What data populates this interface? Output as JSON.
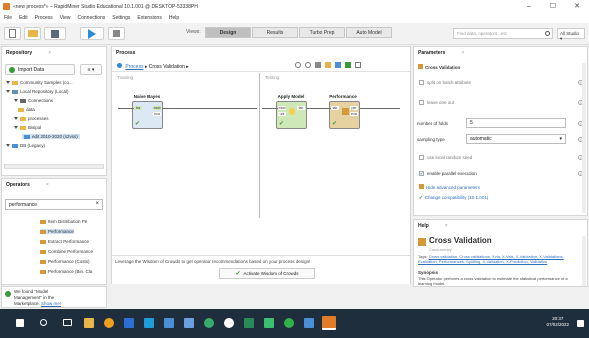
{
  "window": {
    "title": "«new process*» – RapidMiner Studio Educational 10.1.001 @ DESKTOP-53338PH"
  },
  "menu": [
    "File",
    "Edit",
    "Process",
    "View",
    "Connections",
    "Settings",
    "Extensions",
    "Help"
  ],
  "toolbar": {
    "views_label": "Views:",
    "views": [
      "Design",
      "Results",
      "Turbo Prep",
      "Auto Model"
    ],
    "active_view": "Design",
    "search_placeholder": "Find data, operators...etc",
    "all_studio": "All Studio ▾"
  },
  "repository": {
    "tab": "Repository",
    "close": "×",
    "import_label": "Import Data",
    "menu_label": "≡ ▾",
    "items": [
      {
        "label": "Community Samples (co...",
        "indent": 0
      },
      {
        "label": "Local Repository (Local)",
        "indent": 0
      },
      {
        "label": "Connections",
        "indent": 1
      },
      {
        "label": "data",
        "indent": 1
      },
      {
        "label": "processes",
        "indent": 1
      },
      {
        "label": "Bisipol",
        "indent": 1
      },
      {
        "label": "edit 2010-2020 (s2vss)",
        "indent": 2
      },
      {
        "label": "DB (Legacy)",
        "indent": 0
      }
    ]
  },
  "operators": {
    "tab": "Operators",
    "close": "×",
    "search_value": "performance",
    "items": [
      "Item Distribution Pe",
      "Performance",
      "Extract Performance",
      "Combine Performance",
      "Performance (Costs)",
      "Performance (Bin. Cla"
    ],
    "footer_line1": "We found \"Model",
    "footer_line2": "Management\" in the",
    "footer_line3": "Marketplace.",
    "footer_link": "Show me!"
  },
  "process": {
    "tab": "Process",
    "breadcrumb_root": "Process",
    "breadcrumb_sep": "▸",
    "breadcrumb_leaf": "Cross Validation ▸",
    "training_label": "Training",
    "testing_label": "Testing",
    "naive_bayes": "Naive Bayes",
    "apply_model": "Apply Model",
    "performance": "Performance",
    "ports": {
      "tra": "tra",
      "mod": "mod",
      "exa": "exa",
      "thr": "thr",
      "unl": "unl",
      "lab": "lab",
      "per": "per"
    },
    "wisdom_text": "Leverage the Wisdom of Crowds to get operator recommendations based on your process design!",
    "wisdom_button": "Activate Wisdom of Crowds"
  },
  "parameters": {
    "tab": "Parameters",
    "close": "×",
    "section": "Cross Validation",
    "split_on_batch": "split on batch attribute",
    "leave_one_out": "leave one out",
    "num_folds_label": "number of folds",
    "num_folds_value": "5",
    "sampling_label": "sampling type",
    "sampling_value": "automatic",
    "local_seed": "use local random seed",
    "parallel": "enable parallel execution",
    "hide_advanced": "Hide advanced parameters",
    "compat": "Change compatibility (10.1.001)"
  },
  "help": {
    "tab": "Help",
    "close": "×",
    "title": "Cross Validation",
    "subtitle": "Concurrency",
    "tags_label": "Tags:",
    "tags": "Cross validation, Cross validations, Xvla, X-Vals, X-Validation, X-Validations, Evaluation, Performances, Splitting, X-Validation, X-Prediction, Validation",
    "synopsis_label": "Synopsis",
    "synopsis": "This Operator performs a cross validation to estimate the statistical performance of a learning model."
  },
  "taskbar": {
    "time": "20:37",
    "date": "07/02/2022"
  },
  "colors": {
    "accent": "#4a8fd6",
    "blue_op": "#dde8f5",
    "green_op": "#cfe8b8",
    "gold": "#e6b04a",
    "taskbar": "#1f2e3d"
  }
}
